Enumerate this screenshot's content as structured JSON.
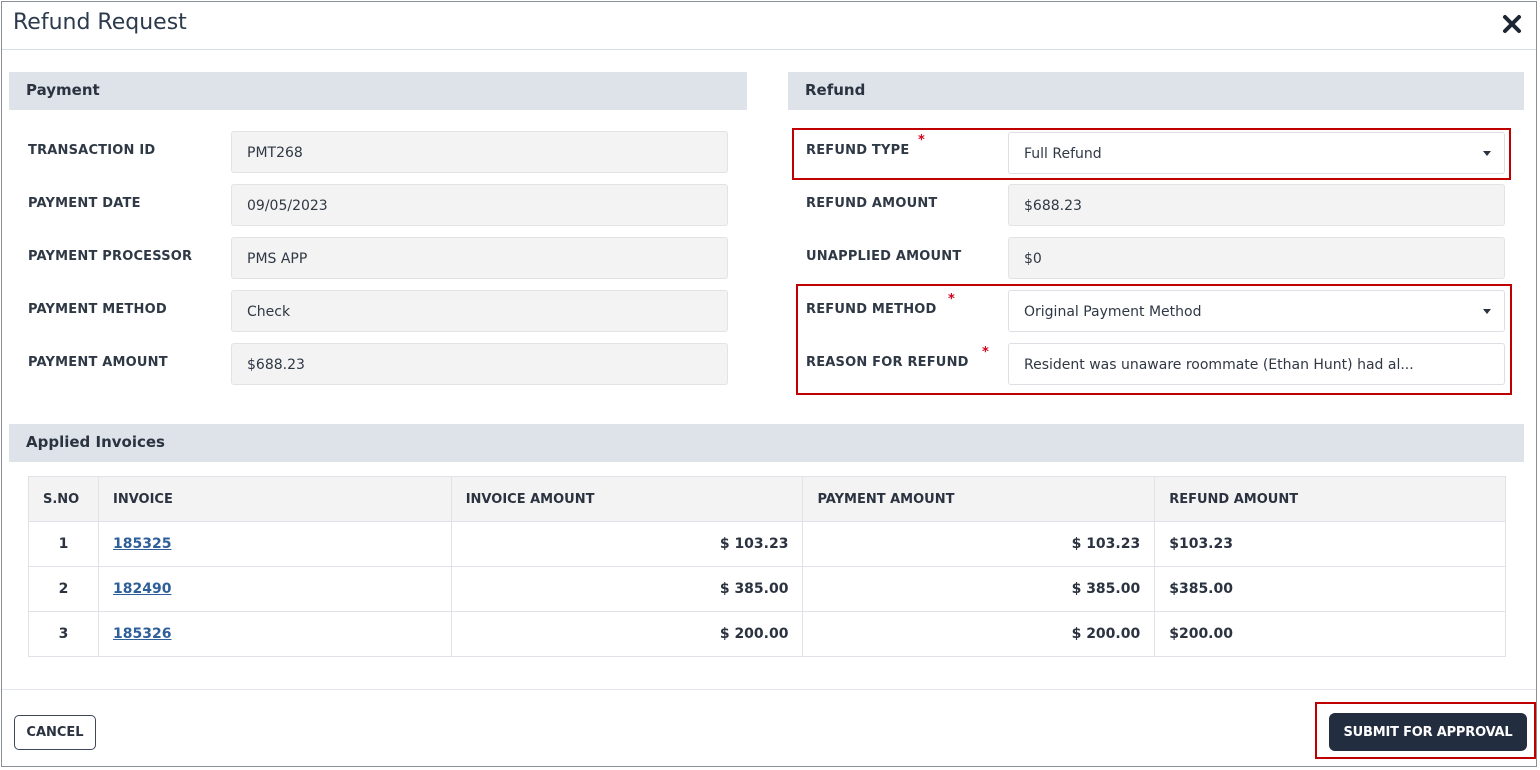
{
  "modal": {
    "title": "Refund Request",
    "close_icon": "close-icon"
  },
  "payment": {
    "section_title": "Payment",
    "fields": [
      {
        "label": "TRANSACTION ID",
        "value": "PMT268"
      },
      {
        "label": "PAYMENT DATE",
        "value": "09/05/2023"
      },
      {
        "label": "PAYMENT PROCESSOR",
        "value": "PMS APP"
      },
      {
        "label": "PAYMENT METHOD",
        "value": "Check"
      },
      {
        "label": "PAYMENT AMOUNT",
        "value": "$688.23"
      }
    ]
  },
  "refund": {
    "section_title": "Refund",
    "refund_type": {
      "label": "REFUND TYPE",
      "value": "Full Refund",
      "required_mark": "*"
    },
    "refund_amount": {
      "label": "REFUND AMOUNT",
      "value": "$688.23"
    },
    "unapplied_amount": {
      "label": "UNAPPLIED AMOUNT",
      "value": "$0"
    },
    "refund_method": {
      "label": "REFUND METHOD",
      "value": "Original Payment Method",
      "required_mark": "*"
    },
    "reason": {
      "label": "REASON FOR REFUND",
      "value": "Resident was unaware roommate (Ethan Hunt) had al...",
      "required_mark": "*"
    }
  },
  "applied_invoices": {
    "section_title": "Applied Invoices",
    "columns": [
      "S.NO",
      "INVOICE",
      "INVOICE AMOUNT",
      "PAYMENT AMOUNT",
      "REFUND AMOUNT"
    ],
    "rows": [
      {
        "sno": "1",
        "invoice": "185325",
        "invoice_amount": "$ 103.23",
        "payment_amount": "$ 103.23",
        "refund_amount": "$103.23"
      },
      {
        "sno": "2",
        "invoice": "182490",
        "invoice_amount": "$ 385.00",
        "payment_amount": "$ 385.00",
        "refund_amount": "$385.00"
      },
      {
        "sno": "3",
        "invoice": "185326",
        "invoice_amount": "$ 200.00",
        "payment_amount": "$ 200.00",
        "refund_amount": "$200.00"
      }
    ]
  },
  "footer": {
    "cancel_label": "CANCEL",
    "submit_label": "SUBMIT FOR APPROVAL"
  },
  "colors": {
    "highlight": "#c00000",
    "primary_button": "#232d40",
    "section_bar": "#dde3e9",
    "link": "#2f5f98",
    "required": "#d0021b"
  }
}
